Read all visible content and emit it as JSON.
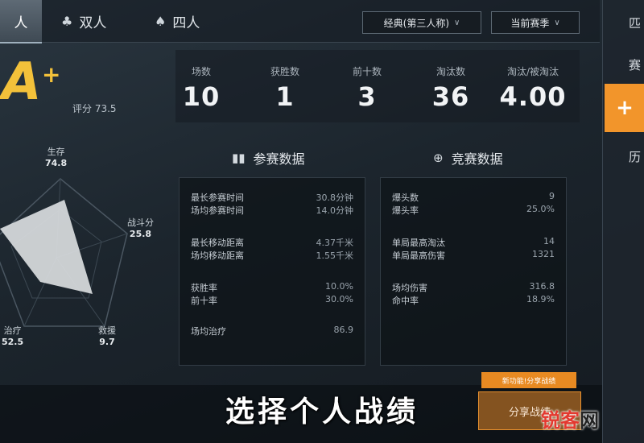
{
  "tabs": [
    {
      "label": "人",
      "icon": "person-icon"
    },
    {
      "label": "双人",
      "icon": "duo-icon"
    },
    {
      "label": "四人",
      "icon": "squad-icon"
    }
  ],
  "filters": {
    "mode": "经典(第三人称)",
    "season": "当前赛季"
  },
  "sidebar": {
    "item1": "匹",
    "item2": "赛",
    "item3": "历",
    "add_label": "+"
  },
  "grade": {
    "letter": "A",
    "plus": "+",
    "score_label": "评分 73.5"
  },
  "stats": [
    {
      "label": "场数",
      "value": "10"
    },
    {
      "label": "获胜数",
      "value": "1"
    },
    {
      "label": "前十数",
      "value": "3"
    },
    {
      "label": "淘汰数",
      "value": "36"
    },
    {
      "label": "淘汰/被淘汰",
      "value": "4.00"
    }
  ],
  "radar": {
    "labels": [
      {
        "name": "生存",
        "value": "74.8"
      },
      {
        "name": "战斗分",
        "value": "25.8"
      },
      {
        "name": "救援",
        "value": "9.7"
      },
      {
        "name": "治疗",
        "value": "52.5"
      }
    ]
  },
  "sections": {
    "participation": "参赛数据",
    "combat": "竞赛数据"
  },
  "participation_rows": [
    {
      "k": "最长参赛时间",
      "v": "30.8分钟"
    },
    {
      "k": "场均参赛时间",
      "v": "14.0分钟"
    },
    {
      "k": "最长移动距离",
      "v": "4.37千米"
    },
    {
      "k": "场均移动距离",
      "v": "1.55千米"
    },
    {
      "k": "获胜率",
      "v": "10.0%"
    },
    {
      "k": "前十率",
      "v": "30.0%"
    },
    {
      "k": "场均治疗",
      "v": "86.9"
    }
  ],
  "combat_rows": [
    {
      "k": "爆头数",
      "v": "9"
    },
    {
      "k": "爆头率",
      "v": "25.0%"
    },
    {
      "k": "单局最高淘汰",
      "v": "14"
    },
    {
      "k": "单局最高伤害",
      "v": "1321"
    },
    {
      "k": "场均伤害",
      "v": "316.8"
    },
    {
      "k": "命中率",
      "v": "18.9%"
    }
  ],
  "bottom": {
    "subtitle": "选择个人战绩",
    "tip": "新功能!分享战绩",
    "share_label": "分享战绩"
  },
  "watermark": {
    "part1": "锐客",
    "part2": "网"
  },
  "colors": {
    "accent": "#f2952b",
    "grade": "#f3c13a",
    "watermark": "#e3392f"
  }
}
